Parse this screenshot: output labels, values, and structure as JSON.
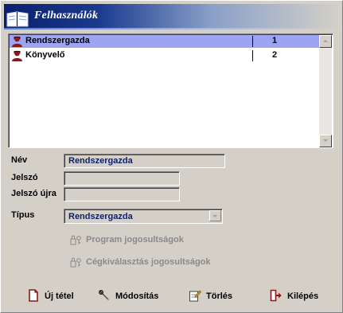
{
  "window": {
    "title": "Felhasználók"
  },
  "users_list": {
    "rows": [
      {
        "name": "Rendszergazda",
        "id": "1",
        "selected": true
      },
      {
        "name": "Könyvelő",
        "id": "2",
        "selected": false
      }
    ]
  },
  "form": {
    "name_label": "Név",
    "name_value": "Rendszergazda",
    "password_label": "Jelszó",
    "password_value": "",
    "password_again_label": "Jelszó újra",
    "password_again_value": "",
    "type_label": "Típus",
    "type_value": "Rendszergazda"
  },
  "permissions": {
    "program_permissions_label": "Program jogosultságok",
    "company_selection_permissions_label": "Cégkiválasztás jogosultságok"
  },
  "buttons": {
    "new_item": "Új tétel",
    "modify": "Módosítás",
    "delete": "Törlés",
    "exit": "Kilépés"
  },
  "colors": {
    "selection": "#9da4f2",
    "field_text": "#0a1f6e",
    "disabled_text": "#8a8a8a",
    "icon_red": "#8b1a1a"
  }
}
